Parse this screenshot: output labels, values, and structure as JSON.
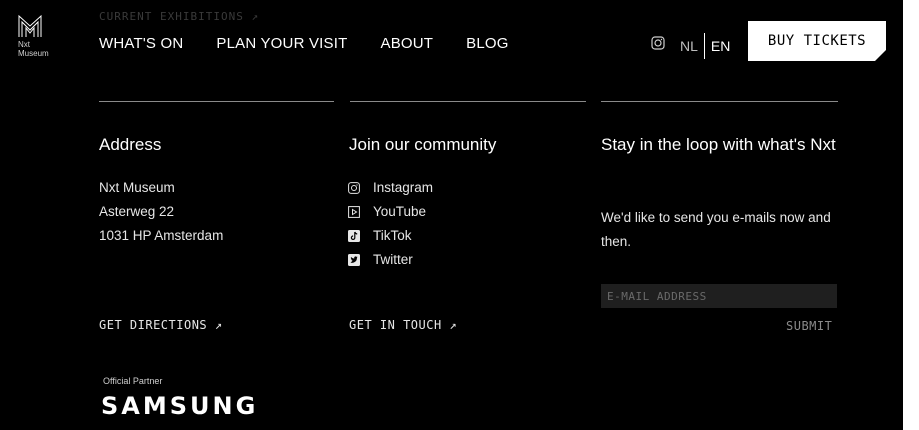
{
  "header": {
    "logo_text": "Nxt\nMuseum",
    "faded_link": "CURRENT EXHIBITIONS ↗",
    "nav": [
      "WHAT'S ON",
      "PLAN YOUR VISIT",
      "ABOUT",
      "BLOG"
    ],
    "lang_nl": "NL",
    "lang_en": "EN",
    "buy_tickets": "BUY TICKETS"
  },
  "address": {
    "title": "Address",
    "line1": "Nxt Museum",
    "line2": "Asterweg 22",
    "line3": "1031 HP Amsterdam",
    "cta": "GET DIRECTIONS ↗"
  },
  "community": {
    "title": "Join our community",
    "items": [
      {
        "label": "Instagram",
        "icon": "instagram-icon"
      },
      {
        "label": "YouTube",
        "icon": "youtube-icon"
      },
      {
        "label": "TikTok",
        "icon": "tiktok-icon"
      },
      {
        "label": "Twitter",
        "icon": "twitter-icon"
      }
    ],
    "cta": "GET IN TOUCH ↗"
  },
  "newsletter": {
    "title": "Stay in the loop with what's Nxt",
    "body": "We'd like to send you e-mails now and then.",
    "email_placeholder": "E-MAIL ADDRESS",
    "submit": "SUBMIT"
  },
  "partner": {
    "label": "Official Partner",
    "name": "SAMSUNG"
  },
  "colors": {
    "background": "#000000",
    "text": "#ffffff",
    "button_bg": "#ffffff"
  }
}
